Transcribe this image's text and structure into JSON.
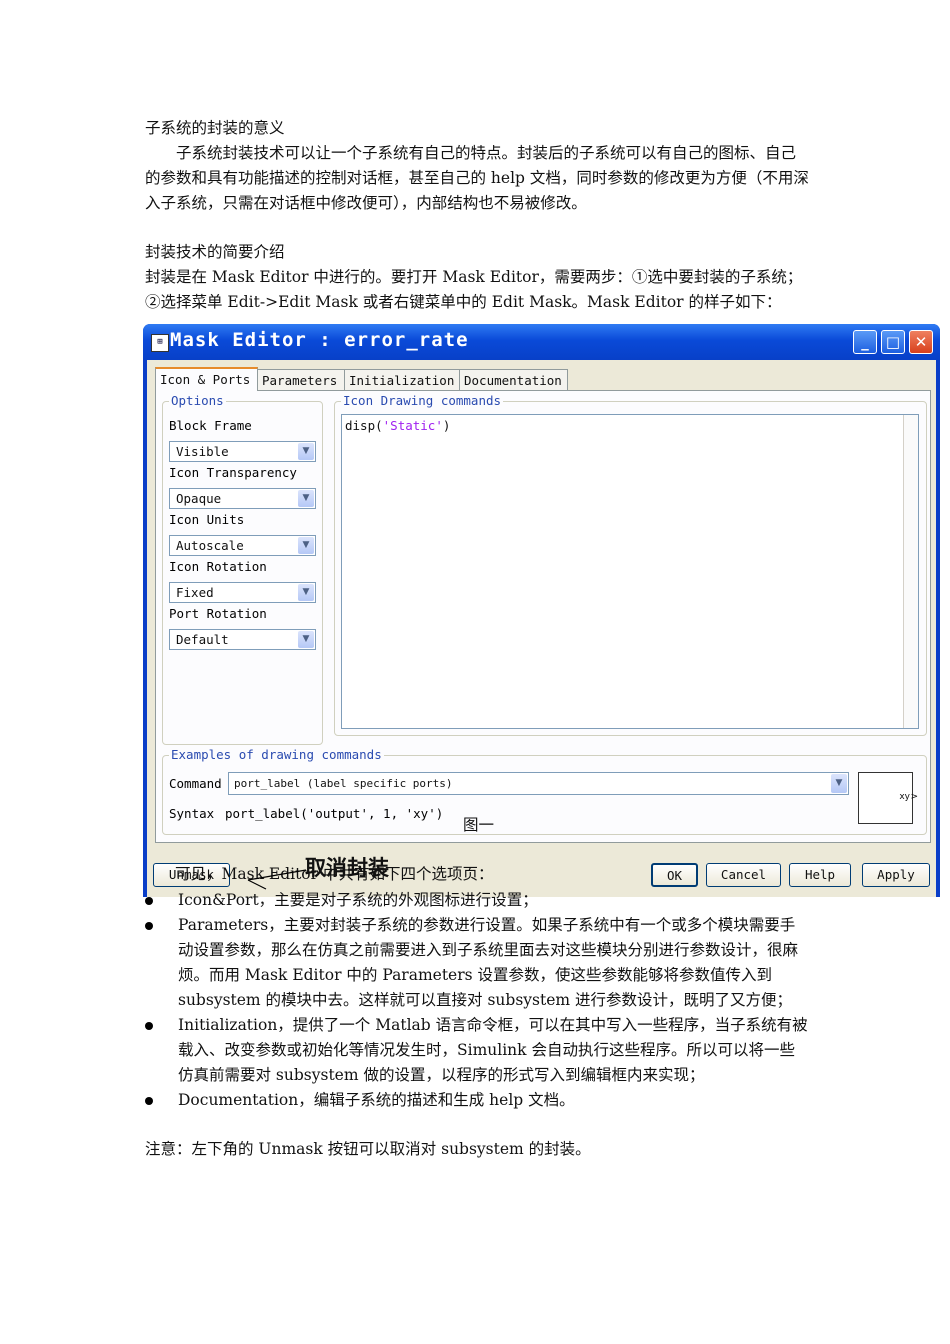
{
  "doc": {
    "heading1": "子系统的封装的意义",
    "para1": "子系统封装技术可以让一个子系统有自己的特点。封装后的子系统可以有自己的图标、自己的参数和具有功能描述的控制对话框，甚至自己的 help 文档，同时参数的修改更为方便（不用深入子系统，只需在对话框中修改便可），内部结构也不易被修改。",
    "heading2": "封装技术的简要介绍",
    "para2": "封装是在 Mask Editor 中进行的。要打开 Mask Editor，需要两步：①选中要封装的子系统；②选择菜单 Edit->Edit Mask 或者右键菜单中的 Edit Mask。Mask Editor 的样子如下：",
    "figure_caption": "图一",
    "overlay_text": "可见，Mask Editor 中共有如下四个选项页：",
    "overlay_label": "取消封装",
    "bullets": [
      "Icon&Port，主要是对子系统的外观图标进行设置；",
      "Parameters，主要对封装子系统的参数进行设置。如果子系统中有一个或多个模块需要手动设置参数，那么在仿真之前需要进入到子系统里面去对这些模块分别进行参数设计，很麻烦。而用 Mask Editor 中的 Parameters 设置参数，使这些参数能够将参数值传入到 subsystem 的模块中去。这样就可以直接对 subsystem 进行参数设计，既明了又方便；",
      "Initialization，提供了一个 Matlab 语言命令框，可以在其中写入一些程序，当子系统有被载入、改变参数或初始化等情况发生时，Simulink 会自动执行这些程序。所以可以将一些仿真前需要对 subsystem 做的设置，以程序的形式写入到编辑框内来实现；",
      "Documentation，编辑子系统的描述和生成 help 文档。"
    ],
    "note": "注意：左下角的 Unmask 按钮可以取消对 subsystem 的封装。"
  },
  "window": {
    "title": "Mask Editor : error_rate",
    "tabs": [
      "Icon & Ports",
      "Parameters",
      "Initialization",
      "Documentation"
    ],
    "options_legend": "Options",
    "options": [
      {
        "label": "Block Frame",
        "value": "Visible"
      },
      {
        "label": "Icon Transparency",
        "value": "Opaque"
      },
      {
        "label": "Icon Units",
        "value": "Autoscale"
      },
      {
        "label": "Icon Rotation",
        "value": "Fixed"
      },
      {
        "label": "Port Rotation",
        "value": "Default"
      }
    ],
    "drawing_legend": "Icon Drawing commands",
    "drawing_code_fn": "disp(",
    "drawing_code_str": "'Static'",
    "drawing_code_end": ")",
    "examples_legend": "Examples of drawing commands",
    "command_label": "Command",
    "command_value": "port_label (label specific ports)",
    "syntax_label": "Syntax",
    "syntax_value": "port_label('output', 1, 'xy')",
    "preview_text": "xy",
    "buttons": {
      "unmask": "Unmask",
      "ok": "OK",
      "cancel": "Cancel",
      "help": "Help",
      "apply": "Apply"
    }
  }
}
